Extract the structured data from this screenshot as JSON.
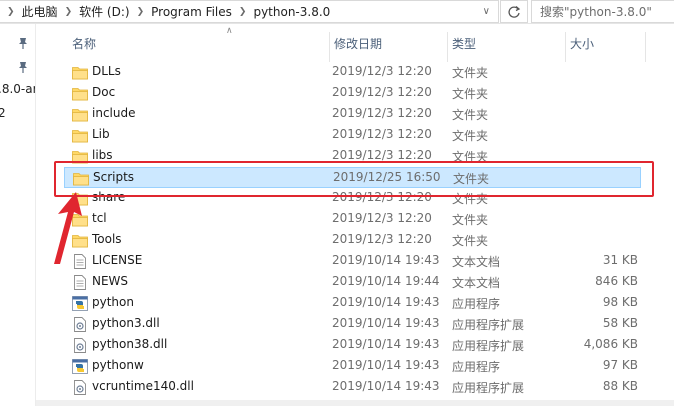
{
  "address": {
    "crumbs": [
      "此电脑",
      "软件 (D:)",
      "Program Files",
      "python-3.8.0"
    ],
    "search_placeholder": "搜索\"python-3.8.0\""
  },
  "nav": {
    "partial_item": ".8.0-ar",
    "partial_item2": "2"
  },
  "columns": {
    "name": "名称",
    "date": "修改日期",
    "type": "类型",
    "size": "大小"
  },
  "files": [
    {
      "name": "DLLs",
      "date": "2019/12/3 12:20",
      "type": "文件夹",
      "size": "",
      "icon": "folder-icon"
    },
    {
      "name": "Doc",
      "date": "2019/12/3 12:20",
      "type": "文件夹",
      "size": "",
      "icon": "folder-icon"
    },
    {
      "name": "include",
      "date": "2019/12/3 12:20",
      "type": "文件夹",
      "size": "",
      "icon": "folder-icon"
    },
    {
      "name": "Lib",
      "date": "2019/12/3 12:20",
      "type": "文件夹",
      "size": "",
      "icon": "folder-icon"
    },
    {
      "name": "libs",
      "date": "2019/12/3 12:20",
      "type": "文件夹",
      "size": "",
      "icon": "folder-icon"
    },
    {
      "name": "Scripts",
      "date": "2019/12/25 16:50",
      "type": "文件夹",
      "size": "",
      "icon": "folder-icon",
      "selected": true
    },
    {
      "name": "share",
      "date": "2019/12/3 12:20",
      "type": "文件夹",
      "size": "",
      "icon": "folder-icon"
    },
    {
      "name": "tcl",
      "date": "2019/12/3 12:20",
      "type": "文件夹",
      "size": "",
      "icon": "folder-icon"
    },
    {
      "name": "Tools",
      "date": "2019/12/3 12:20",
      "type": "文件夹",
      "size": "",
      "icon": "folder-icon"
    },
    {
      "name": "LICENSE",
      "date": "2019/10/14 19:43",
      "type": "文本文档",
      "size": "31 KB",
      "icon": "text-file-icon"
    },
    {
      "name": "NEWS",
      "date": "2019/10/14 19:44",
      "type": "文本文档",
      "size": "846 KB",
      "icon": "text-file-icon"
    },
    {
      "name": "python",
      "date": "2019/10/14 19:43",
      "type": "应用程序",
      "size": "98 KB",
      "icon": "python-exe-icon"
    },
    {
      "name": "python3.dll",
      "date": "2019/10/14 19:43",
      "type": "应用程序扩展",
      "size": "58 KB",
      "icon": "dll-file-icon"
    },
    {
      "name": "python38.dll",
      "date": "2019/10/14 19:43",
      "type": "应用程序扩展",
      "size": "4,086 KB",
      "icon": "dll-file-icon"
    },
    {
      "name": "pythonw",
      "date": "2019/10/14 19:43",
      "type": "应用程序",
      "size": "97 KB",
      "icon": "pythonw-exe-icon"
    },
    {
      "name": "vcruntime140.dll",
      "date": "2019/10/14 19:43",
      "type": "应用程序扩展",
      "size": "88 KB",
      "icon": "dll-file-icon"
    }
  ],
  "colors": {
    "selected_bg": "#cce8ff",
    "selected_border": "#99d1ff",
    "annotation_red": "#e0262f",
    "folder_yellow": "#ffd866"
  }
}
